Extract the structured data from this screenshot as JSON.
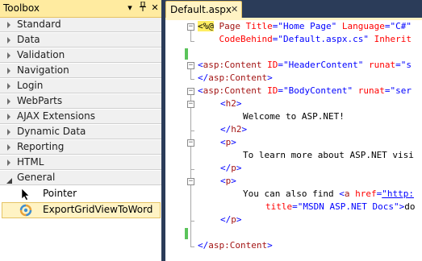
{
  "toolbox": {
    "title": "Toolbox",
    "dropdown_glyph": "▾",
    "pin_glyph": "ᛘ",
    "close_glyph": "✕",
    "categories": [
      {
        "label": "Standard"
      },
      {
        "label": "Data"
      },
      {
        "label": "Validation"
      },
      {
        "label": "Navigation"
      },
      {
        "label": "Login"
      },
      {
        "label": "WebParts"
      },
      {
        "label": "AJAX Extensions"
      },
      {
        "label": "Dynamic Data"
      },
      {
        "label": "Reporting"
      },
      {
        "label": "HTML"
      },
      {
        "label": "General"
      }
    ],
    "general_items": [
      {
        "label": "Pointer",
        "icon": "pointer-arrow-icon"
      },
      {
        "label": "ExportGridViewToWord",
        "icon": "gear-component-icon",
        "selected": true
      }
    ]
  },
  "editor": {
    "tab_label": "Default.aspx",
    "tab_close": "✕",
    "lines": {
      "l1a": "<%@",
      "l1b": " Page ",
      "l1c": "Title",
      "l1d": "=",
      "l1e": "\"Home Page\"",
      "l1f": " ",
      "l1g": "Language",
      "l1h": "=",
      "l1i": "\"C#\"",
      "l2a": "    ",
      "l2b": "CodeBehind",
      "l2c": "=",
      "l2d": "\"Default.aspx.cs\"",
      "l2e": " ",
      "l2f": "Inherit",
      "l4a": "<",
      "l4b": "asp:Content",
      "l4c": " ",
      "l4d": "ID",
      "l4e": "=",
      "l4f": "\"HeaderContent\"",
      "l4g": " ",
      "l4h": "runat",
      "l4i": "=",
      "l4j": "\"s",
      "l5a": "</",
      "l5b": "asp:Content",
      "l5c": ">",
      "l6a": "<",
      "l6b": "asp:Content",
      "l6c": " ",
      "l6d": "ID",
      "l6e": "=",
      "l6f": "\"BodyContent\"",
      "l6g": " ",
      "l6h": "runat",
      "l6i": "=",
      "l6j": "\"ser",
      "l7a": "<",
      "l7b": "h2",
      "l7c": ">",
      "l8": "Welcome to ASP.NET!",
      "l9a": "</",
      "l9b": "h2",
      "l9c": ">",
      "l10a": "<",
      "l10b": "p",
      "l10c": ">",
      "l11": "To learn more about ASP.NET visi",
      "l12a": "</",
      "l12b": "p",
      "l12c": ">",
      "l13a": "<",
      "l13b": "p",
      "l13c": ">",
      "l14a": "You can also find ",
      "l14b": "<",
      "l14c": "a",
      "l14d": " ",
      "l14e": "href",
      "l14f": "=",
      "l14g": "\"http:",
      "l15a": "title",
      "l15b": "=",
      "l15c": "\"MSDN ASP.NET Docs\"",
      "l15d": ">",
      "l15e": "do",
      "l16a": "</",
      "l16b": "p",
      "l16c": ">",
      "l18a": "</",
      "l18b": "asp:Content",
      "l18c": ">"
    }
  },
  "colors": {
    "window_bg": "#2b3c59",
    "toolbox_header": "#ffeba0",
    "selected_item": "#fff3c4",
    "tag": "#a31515",
    "attribute": "#ff0000",
    "value": "#0000ff",
    "change_marker": "#5bc35b"
  }
}
